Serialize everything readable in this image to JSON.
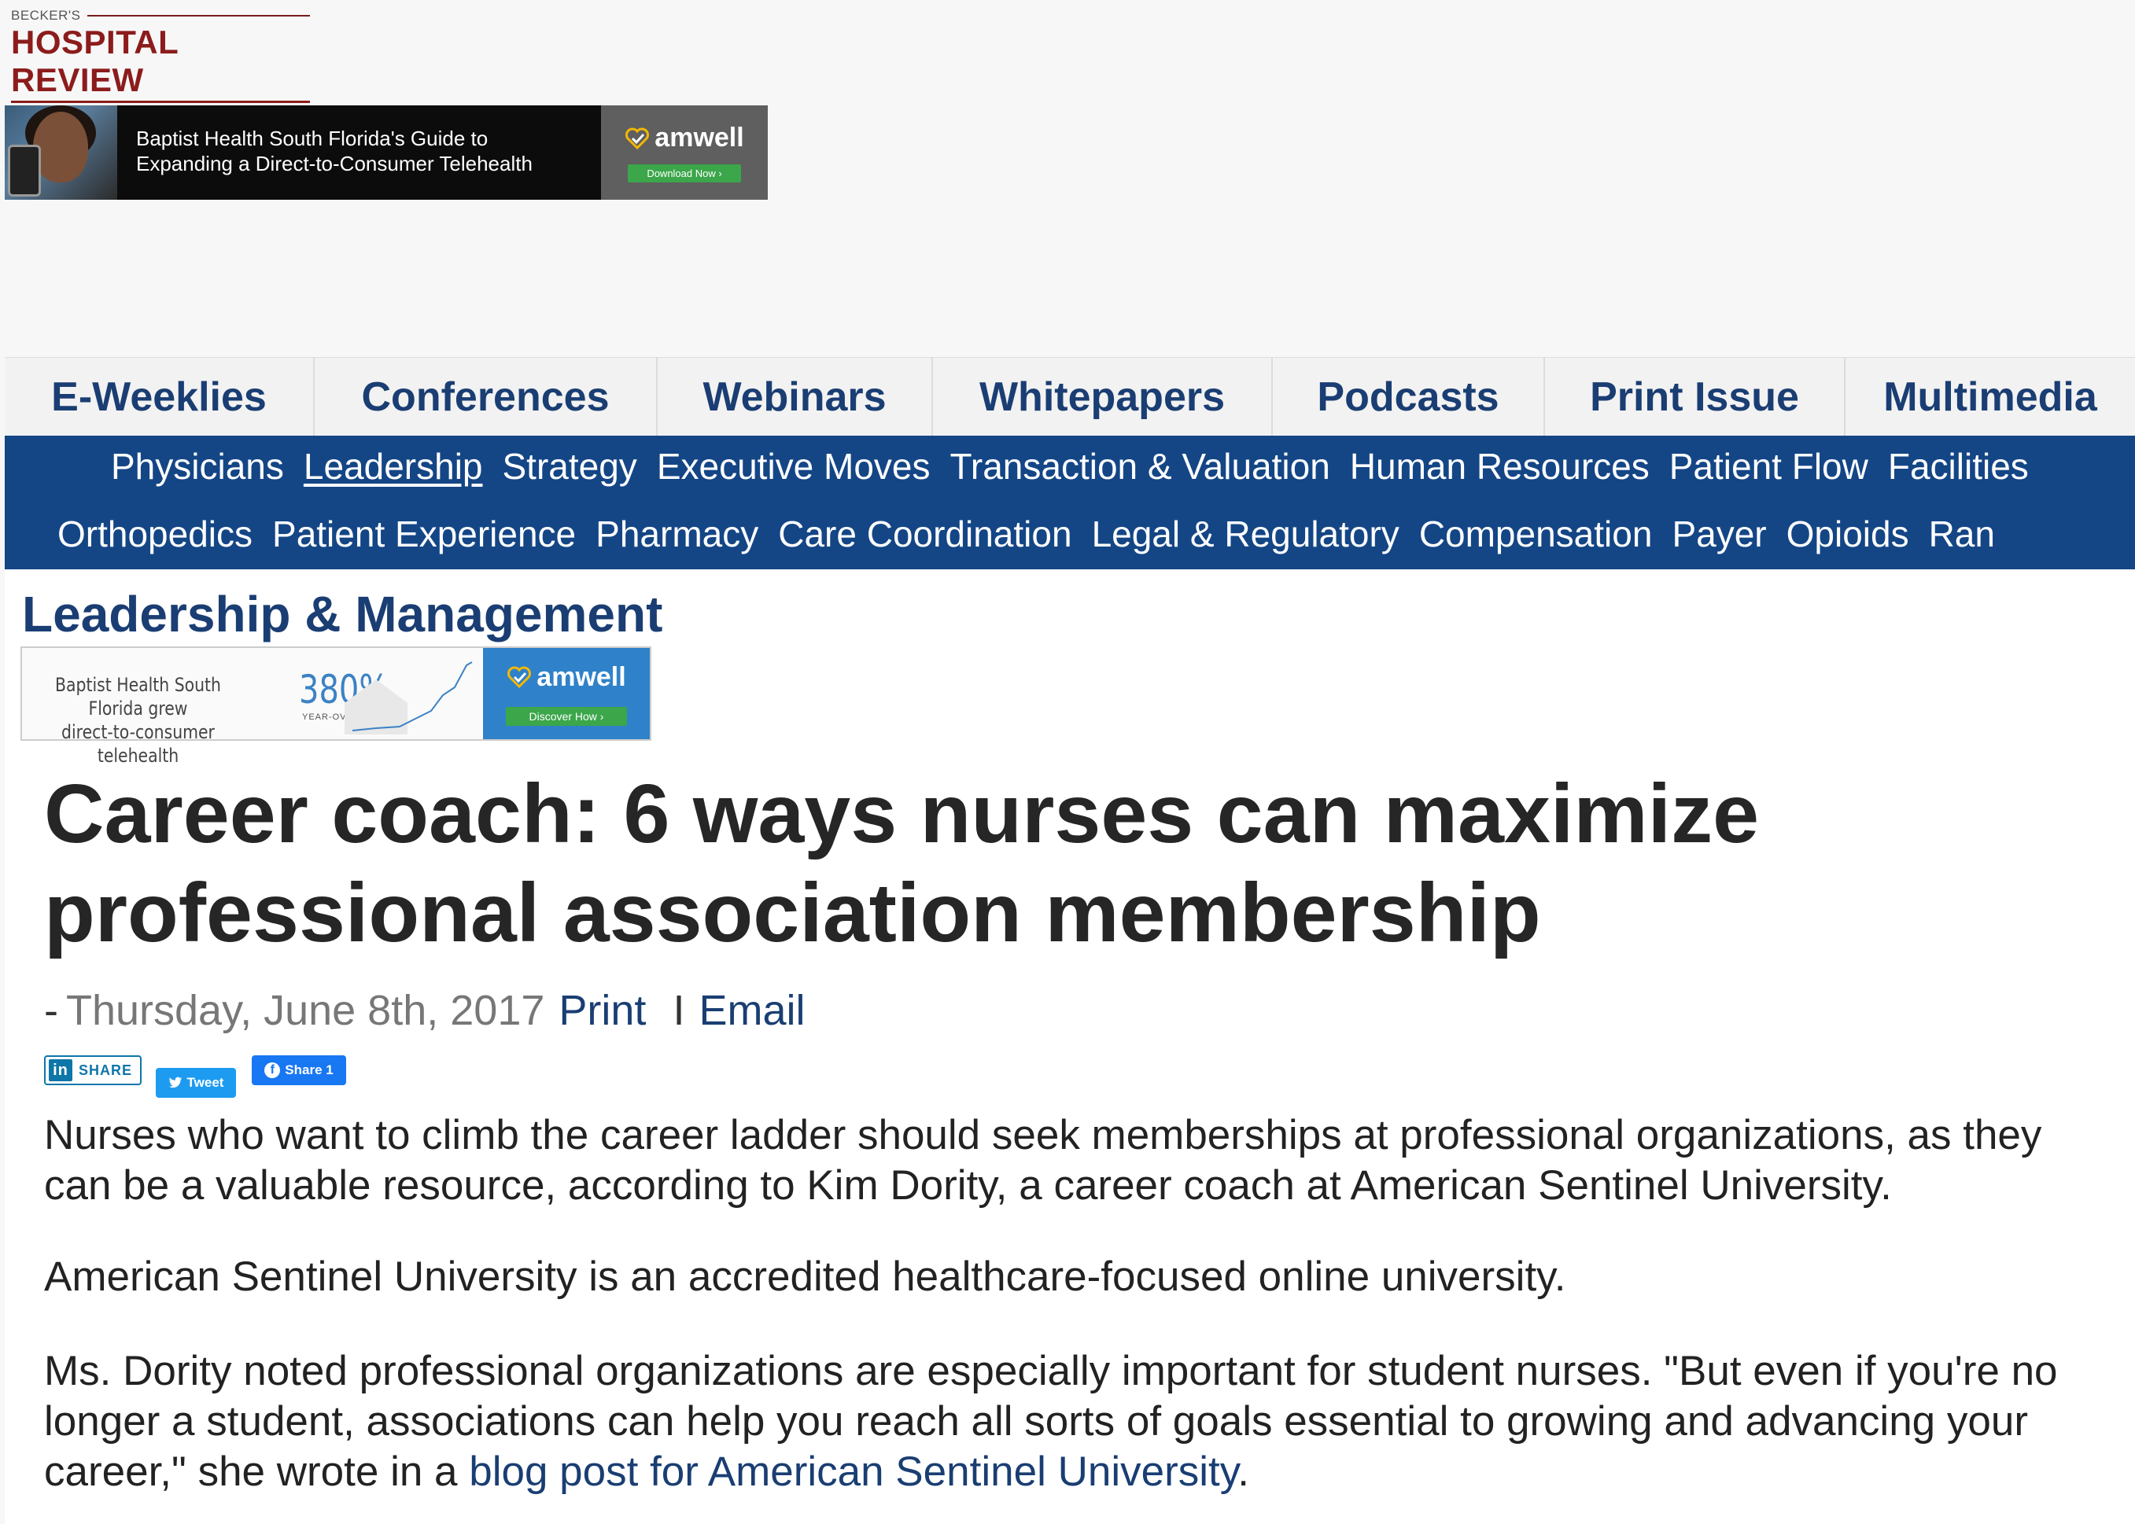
{
  "logo": {
    "small": "BECKER'S",
    "big": "HOSPITAL REVIEW"
  },
  "top_ad": {
    "copy_line1": "Baptist Health South Florida's Guide to",
    "copy_line2": "Expanding a Direct-to-Consumer Telehealth",
    "brand": "amwell",
    "button": "Download Now ›",
    "accent": "#3ba64a"
  },
  "top_nav": [
    "E-Weeklies",
    "Conferences",
    "Webinars",
    "Whitepapers",
    "Podcasts",
    "Print Issue",
    "Multimedia"
  ],
  "categories": {
    "row1": [
      "Physicians",
      "Leadership",
      "Strategy",
      "Executive Moves",
      "Transaction & Valuation",
      "Human Resources",
      "Patient Flow",
      "Facilities"
    ],
    "row2": [
      "Orthopedics",
      "Patient Experience",
      "Pharmacy",
      "Care Coordination",
      "Legal & Regulatory",
      "Compensation",
      "Payer",
      "Opioids",
      "Ran"
    ],
    "active": "Leadership",
    "bar_color": "#144686"
  },
  "section_title": "Leadership & Management",
  "mid_ad": {
    "text_line1": "Baptist Health South Florida grew",
    "text_line2": "direct-to-consumer telehealth",
    "percent": "380%",
    "yoy": "YEAR-OVER-YEAR",
    "brand": "amwell",
    "button": "Discover How ›"
  },
  "article": {
    "headline": "Career coach: 6 ways nurses can maximize professional association membership",
    "dash": "-",
    "date": "Thursday, June 8th, 2017",
    "print_label": "Print",
    "separator": "I",
    "email_label": "Email",
    "share": {
      "linkedin": "SHARE",
      "linkedin_icon": "in",
      "tweet": "Tweet",
      "facebook": "Share 1",
      "facebook_icon": "f"
    },
    "p1": "Nurses who want to climb the career ladder should seek memberships at professional organizations, as they can be a valuable resource, according to Kim Dority, a career coach at American Sentinel University.",
    "p2": "American Sentinel University is an accredited healthcare-focused online university.",
    "p3_text": "Ms. Dority noted professional organizations are especially important for student nurses. \"But even if you're no longer a student, associations can help you reach all sorts of goals essential to growing and advancing your career,\" she wrote in a ",
    "p3_link": "blog post for American Sentinel University",
    "p3_end": "."
  },
  "colors": {
    "brand_red": "#8c1c1c",
    "nav_blue": "#1a3e73"
  }
}
